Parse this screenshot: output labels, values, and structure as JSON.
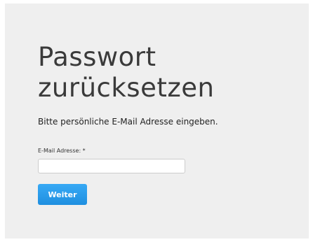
{
  "page": {
    "title": "Passwort\nzurücksetzen",
    "subtitle": "Bitte persönliche E-Mail Adresse eingeben."
  },
  "form": {
    "email_label": "E-Mail Adresse: *",
    "email_value": "",
    "email_placeholder": "",
    "submit_label": "Weiter"
  },
  "colors": {
    "panel_background": "#efefef",
    "button_background": "#2b9ff0",
    "button_text": "#ffffff",
    "title_text": "#3a3a3a"
  }
}
